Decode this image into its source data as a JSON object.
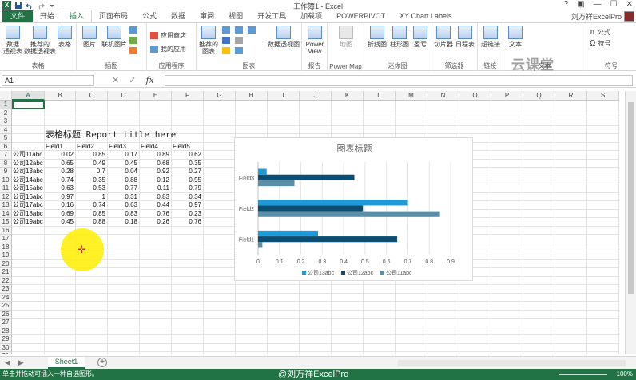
{
  "window": {
    "title": "工作簿1 - Excel",
    "controls": [
      "?",
      "▣",
      "—",
      "☐",
      "✕"
    ]
  },
  "tabs": [
    "文件",
    "开始",
    "插入",
    "页面布局",
    "公式",
    "数据",
    "审阅",
    "视图",
    "开发工具",
    "加载项",
    "POWERPIVOT",
    "XY Chart Labels"
  ],
  "active_tab": "插入",
  "user": "刘万祥ExcelPro",
  "ribbon": {
    "groups": [
      {
        "label": "表格",
        "buttons": [
          "数据\n透视表",
          "推荐的\n数据透视表",
          "表格"
        ]
      },
      {
        "label": "插图",
        "buttons": [
          "图片",
          "联机图片"
        ]
      },
      {
        "label": "应用程序",
        "buttons": [
          "应用商店",
          "我的应用"
        ]
      },
      {
        "label": "图表",
        "buttons": [
          "推荐的\n图表",
          "数据透视图"
        ]
      },
      {
        "label": "报告",
        "buttons": [
          "Power\nView"
        ]
      },
      {
        "label": "Power Map",
        "buttons": [
          "地图"
        ]
      },
      {
        "label": "迷你图",
        "buttons": [
          "折线图",
          "柱形图",
          "盈亏"
        ]
      },
      {
        "label": "筛选器",
        "buttons": [
          "切片器",
          "日程表"
        ]
      },
      {
        "label": "链接",
        "buttons": [
          "超链接"
        ]
      },
      {
        "label": "文本",
        "buttons": [
          "文本"
        ]
      },
      {
        "label": "符号",
        "buttons": [
          "公式",
          "符号"
        ]
      }
    ],
    "watermark": "云课堂"
  },
  "formula_bar": {
    "name_box": "A1",
    "fx": "fx",
    "value": ""
  },
  "columns": [
    "A",
    "B",
    "C",
    "D",
    "E",
    "F",
    "G",
    "H",
    "I",
    "J",
    "K",
    "L",
    "M",
    "N",
    "O",
    "P",
    "Q",
    "R",
    "S"
  ],
  "sheet": {
    "report_title": "表格标题 Report title here",
    "headers": [
      "Field1",
      "Field2",
      "Field3",
      "Field4",
      "Field5"
    ],
    "rows": [
      {
        "name": "公司11abc",
        "v": [
          "0.02",
          "0.85",
          "0.17",
          "0.89",
          "0.62"
        ]
      },
      {
        "name": "公司12abc",
        "v": [
          "0.65",
          "0.49",
          "0.45",
          "0.68",
          "0.35"
        ]
      },
      {
        "name": "公司13abc",
        "v": [
          "0.28",
          "0.7",
          "0.04",
          "0.92",
          "0.27"
        ]
      },
      {
        "name": "公司14abc",
        "v": [
          "0.74",
          "0.35",
          "0.88",
          "0.12",
          "0.95"
        ]
      },
      {
        "name": "公司15abc",
        "v": [
          "0.63",
          "0.53",
          "0.77",
          "0.11",
          "0.79"
        ]
      },
      {
        "name": "公司16abc",
        "v": [
          "0.97",
          "1",
          "0.31",
          "0.83",
          "0.34"
        ]
      },
      {
        "name": "公司17abc",
        "v": [
          "0.16",
          "0.74",
          "0.63",
          "0.44",
          "0.97"
        ]
      },
      {
        "name": "公司18abc",
        "v": [
          "0.69",
          "0.85",
          "0.83",
          "0.76",
          "0.23"
        ]
      },
      {
        "name": "公司19abc",
        "v": [
          "0.45",
          "0.88",
          "0.18",
          "0.26",
          "0.76"
        ]
      }
    ]
  },
  "chart_data": {
    "type": "bar",
    "orientation": "horizontal",
    "title": "图表标题",
    "categories": [
      "Field1",
      "Field2",
      "Field3"
    ],
    "series": [
      {
        "name": "公司13abc",
        "color": "#1f9ad6",
        "values": [
          0.28,
          0.7,
          0.04
        ]
      },
      {
        "name": "公司12abc",
        "color": "#0e4d72",
        "values": [
          0.65,
          0.49,
          0.45
        ]
      },
      {
        "name": "公司11abc",
        "color": "#5b8fa8",
        "values": [
          0.02,
          0.85,
          0.17
        ]
      }
    ],
    "xlim": [
      0,
      0.9
    ],
    "xticks": [
      "0",
      "0.1",
      "0.2",
      "0.3",
      "0.4",
      "0.5",
      "0.6",
      "0.7",
      "0.8",
      "0.9"
    ],
    "grid": true,
    "legend": "bottom"
  },
  "sheet_tabs": {
    "nav": [
      "◀",
      "▶"
    ],
    "active": "Sheet1",
    "add": "+"
  },
  "status": {
    "text": "单击并拖动可插入一种自选图形。",
    "credit": "@刘万祥ExcelPro",
    "zoom": "100%"
  },
  "colors": {
    "excel_green": "#217346"
  }
}
